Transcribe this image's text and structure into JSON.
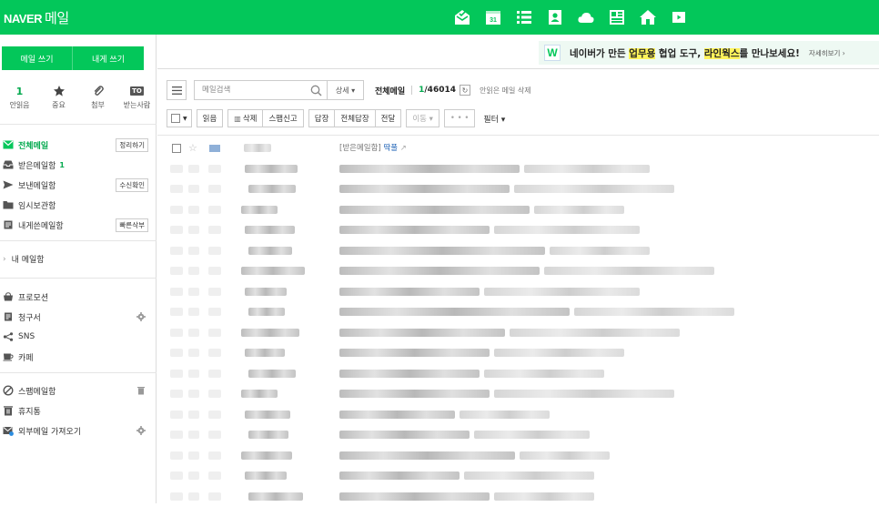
{
  "header": {
    "logo": "NAVER",
    "service": "메일",
    "app_icons": [
      "mail-app-icon",
      "calendar-app-icon",
      "todo-app-icon",
      "contacts-app-icon",
      "cloud-app-icon",
      "note-app-icon",
      "home-app-icon",
      "tv-app-icon"
    ],
    "accent": "#03c75a"
  },
  "sidebar": {
    "write_mail": "메일 쓰기",
    "write_self": "내게 쓰기",
    "quick": [
      {
        "top": "1",
        "label": "안읽음"
      },
      {
        "icon": "star-icon",
        "label": "중요"
      },
      {
        "icon": "paperclip-icon",
        "label": "첨부"
      },
      {
        "badge": "TO",
        "label": "받는사람"
      }
    ],
    "folders": [
      {
        "name": "전체메일",
        "tag": "정리하기"
      },
      {
        "name": "받은메일함",
        "count": "1"
      },
      {
        "name": "보낸메일함",
        "tag": "수신확인"
      },
      {
        "name": "임시보관함"
      },
      {
        "name": "내게쓴메일함",
        "tag": "빠른삭부"
      }
    ],
    "my_mail": "내 메일함",
    "extra": [
      {
        "name": "프로모션"
      },
      {
        "name": "청구서"
      },
      {
        "name": "SNS"
      },
      {
        "name": "카페"
      }
    ],
    "bottom": [
      {
        "name": "스팸메일함"
      },
      {
        "name": "휴지통"
      },
      {
        "name": "외부메일 가져오기"
      }
    ]
  },
  "promo": {
    "pre": "네이버가 만든 ",
    "hl1": "업무용",
    "mid": " 협업 도구, ",
    "hl2": "라인웍스",
    "post": "를 만나보세요!",
    "more": "자세히보기 ›"
  },
  "search": {
    "placeholder": "메일검색",
    "detail": "상세 ▾"
  },
  "list_header": {
    "title": "전체메일",
    "unread": "1",
    "total": "/46014",
    "unread_delete": "안읽은 메일 삭제"
  },
  "toolbar": {
    "read": "읽음",
    "delete": "삭제",
    "spam": "스팸신고",
    "reply": "답장",
    "reply_all": "전체답장",
    "forward": "전달",
    "move": "이동 ▾",
    "more": "• • •",
    "filter": "필터 ▾"
  },
  "first_row": {
    "subject_prefix": "[받은메일함] ",
    "subject": "딱풀"
  }
}
